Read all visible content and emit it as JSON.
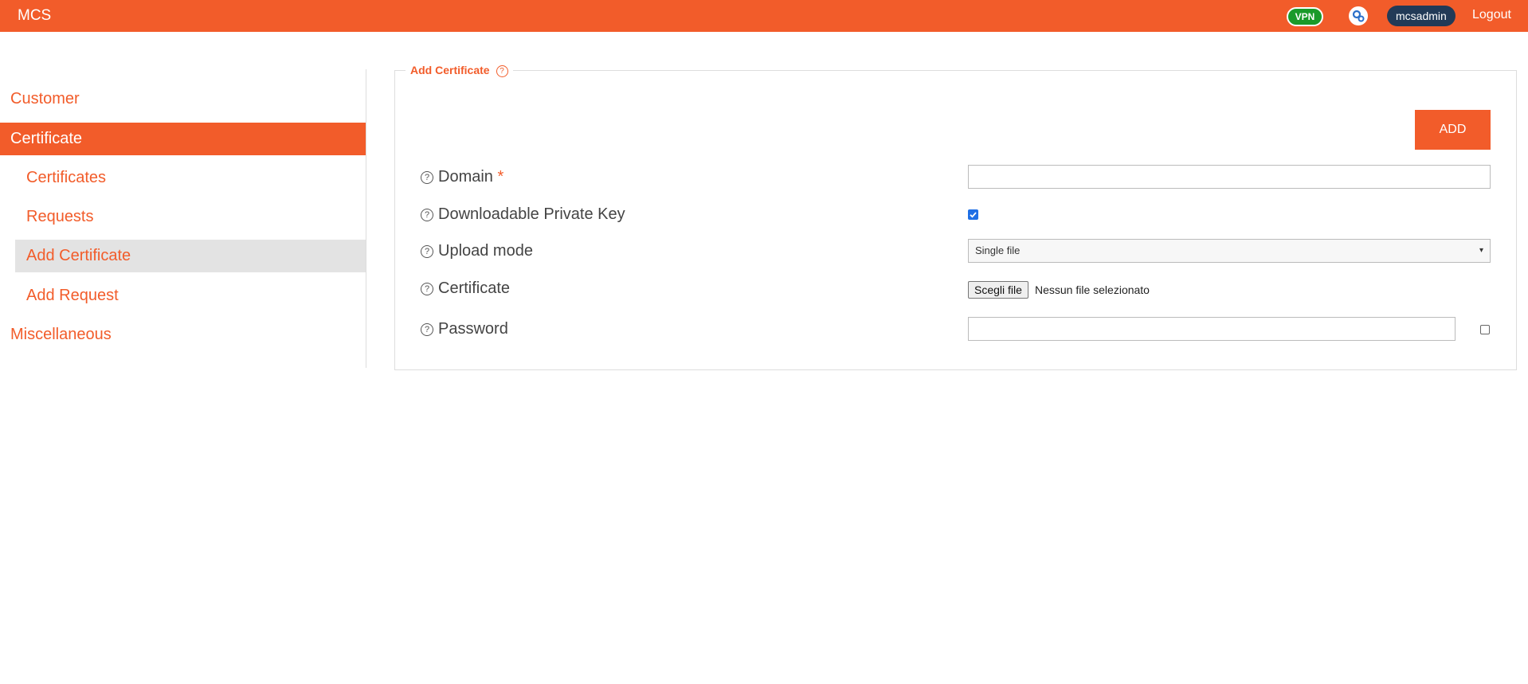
{
  "header": {
    "brand": "MCS",
    "vpn_badge": "VPN",
    "user": "mcsadmin",
    "logout": "Logout",
    "colors": {
      "bar": "#f25c2a",
      "vpn": "#1a9a2a",
      "user": "#223a57"
    }
  },
  "sidebar": {
    "items": [
      {
        "label": "Customer"
      },
      {
        "label": "Certificate"
      },
      {
        "label": "Certificates"
      },
      {
        "label": "Requests"
      },
      {
        "label": "Add Certificate"
      },
      {
        "label": "Add Request"
      },
      {
        "label": "Miscellaneous"
      }
    ]
  },
  "form": {
    "legend": "Add Certificate",
    "add_button": "ADD",
    "fields": {
      "domain": {
        "label": "Domain",
        "required_marker": "*",
        "value": ""
      },
      "private_key": {
        "label": "Downloadable Private Key",
        "checked": true
      },
      "upload_mode": {
        "label": "Upload mode",
        "selected": "Single file"
      },
      "certificate": {
        "label": "Certificate",
        "button": "Scegli file",
        "status": "Nessun file selezionato"
      },
      "password": {
        "label": "Password",
        "value": "",
        "show_checked": false
      }
    },
    "help_glyph": "?"
  }
}
